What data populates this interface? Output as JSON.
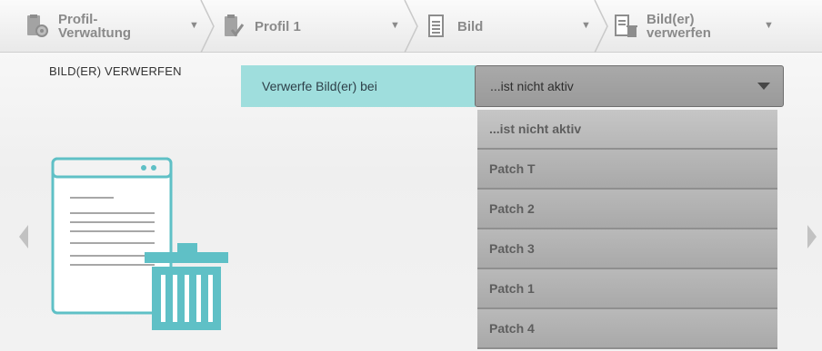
{
  "breadcrumb": [
    {
      "label": "Profil-\nVerwaltung",
      "icon": "profile-gear-icon"
    },
    {
      "label": "Profil 1",
      "icon": "clipboard-icon"
    },
    {
      "label": "Bild",
      "icon": "document-icon"
    },
    {
      "label": "Bild(er)\nverwerfen",
      "icon": "document-trash-icon"
    }
  ],
  "section_title": "BILD(ER) VERWERFEN",
  "field": {
    "label": "Verwerfe Bild(er) bei",
    "selected": "...ist nicht aktiv",
    "options": [
      "...ist nicht aktiv",
      "Patch T",
      "Patch 2",
      "Patch 3",
      "Patch 1",
      "Patch 4"
    ]
  },
  "colors": {
    "accent": "#9fdedd",
    "icon_teal": "#5fc0c6"
  }
}
